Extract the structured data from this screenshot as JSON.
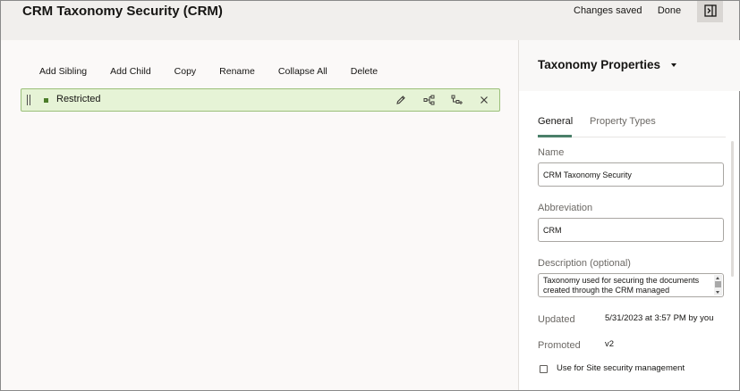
{
  "header": {
    "title": "CRM Taxonomy Security (CRM)",
    "status": "Changes saved",
    "done_label": "Done",
    "panel_toggle_icon": "sidebar-panel-icon"
  },
  "toolbar": {
    "add_sibling": "Add Sibling",
    "add_child": "Add Child",
    "copy": "Copy",
    "rename": "Rename",
    "collapse_all": "Collapse All",
    "delete": "Delete"
  },
  "tree": {
    "selected_node": {
      "label": "Restricted",
      "icons": [
        "pencil-icon",
        "hierarchy-icon",
        "add-child-icon",
        "close-icon"
      ]
    }
  },
  "properties": {
    "title": "Taxonomy Properties",
    "tabs": [
      {
        "label": "General",
        "active": true
      },
      {
        "label": "Property Types",
        "active": false
      }
    ],
    "name_label": "Name",
    "name_value": "CRM Taxonomy Security",
    "abbreviation_label": "Abbreviation",
    "abbreviation_value": "CRM",
    "description_label": "Description (optional)",
    "description_value": "Taxonomy used for securing the documents created through the CRM managed",
    "updated_label": "Updated",
    "updated_value": "5/31/2023 at 3:57 PM by you",
    "promoted_label": "Promoted",
    "promoted_value": "v2",
    "site_security_label": "Use for Site security management",
    "site_security_checked": false
  },
  "colors": {
    "selected_row_bg": "#e6f3d6",
    "selected_row_border": "#9bc07a",
    "tab_indicator": "#4a7f69"
  }
}
